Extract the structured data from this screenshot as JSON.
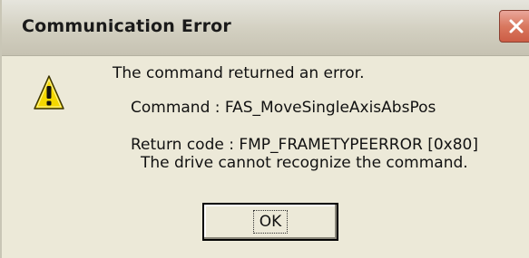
{
  "window": {
    "title": "Communication Error",
    "close_icon": "close-icon"
  },
  "message": {
    "icon": "warning-icon",
    "line1": "The command returned an error.",
    "line2": "Command : FAS_MoveSingleAxisAbsPos",
    "line3": "Return code : FMP_FRAMETYPEERROR [0x80]",
    "line4": "The drive cannot recognize the command."
  },
  "buttons": {
    "ok_label": "OK"
  },
  "colors": {
    "dialog_bg": "#ece9d8",
    "close_button": "#d9785f",
    "warning_yellow": "#f5d800"
  }
}
